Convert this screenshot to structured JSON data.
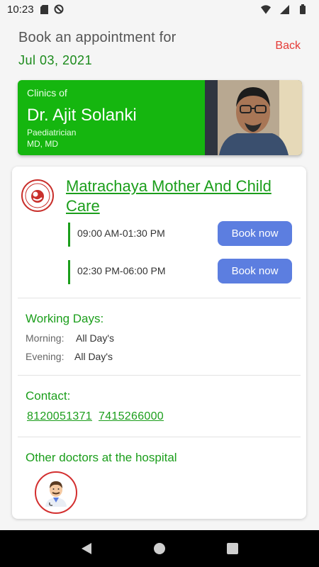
{
  "status_bar": {
    "time": "10:23"
  },
  "header": {
    "title": "Book an appointment for",
    "date": "Jul 03, 2021",
    "back_label": "Back"
  },
  "doctor": {
    "clinics_of": "Clinics of",
    "name": "Dr. Ajit Solanki",
    "specialty": "Paediatrician",
    "degree": "MD, MD"
  },
  "clinic": {
    "name": "Matrachaya Mother And Child Care",
    "slots": [
      {
        "time": "09:00 AM-01:30 PM",
        "button": "Book now"
      },
      {
        "time": "02:30 PM-06:00 PM",
        "button": "Book now"
      }
    ]
  },
  "working_days": {
    "title": "Working Days:",
    "morning_label": "Morning:",
    "morning_value": "All Day's",
    "evening_label": "Evening:",
    "evening_value": "All Day's"
  },
  "contact": {
    "title": "Contact:",
    "phones": [
      "8120051371",
      "7415266000"
    ]
  },
  "other_doctors": {
    "title": "Other doctors at the hospital"
  },
  "colors": {
    "brand_green": "#15b60f",
    "link_green": "#1b9e1b",
    "button_blue": "#5c7ee0",
    "back_red": "#e53935"
  }
}
